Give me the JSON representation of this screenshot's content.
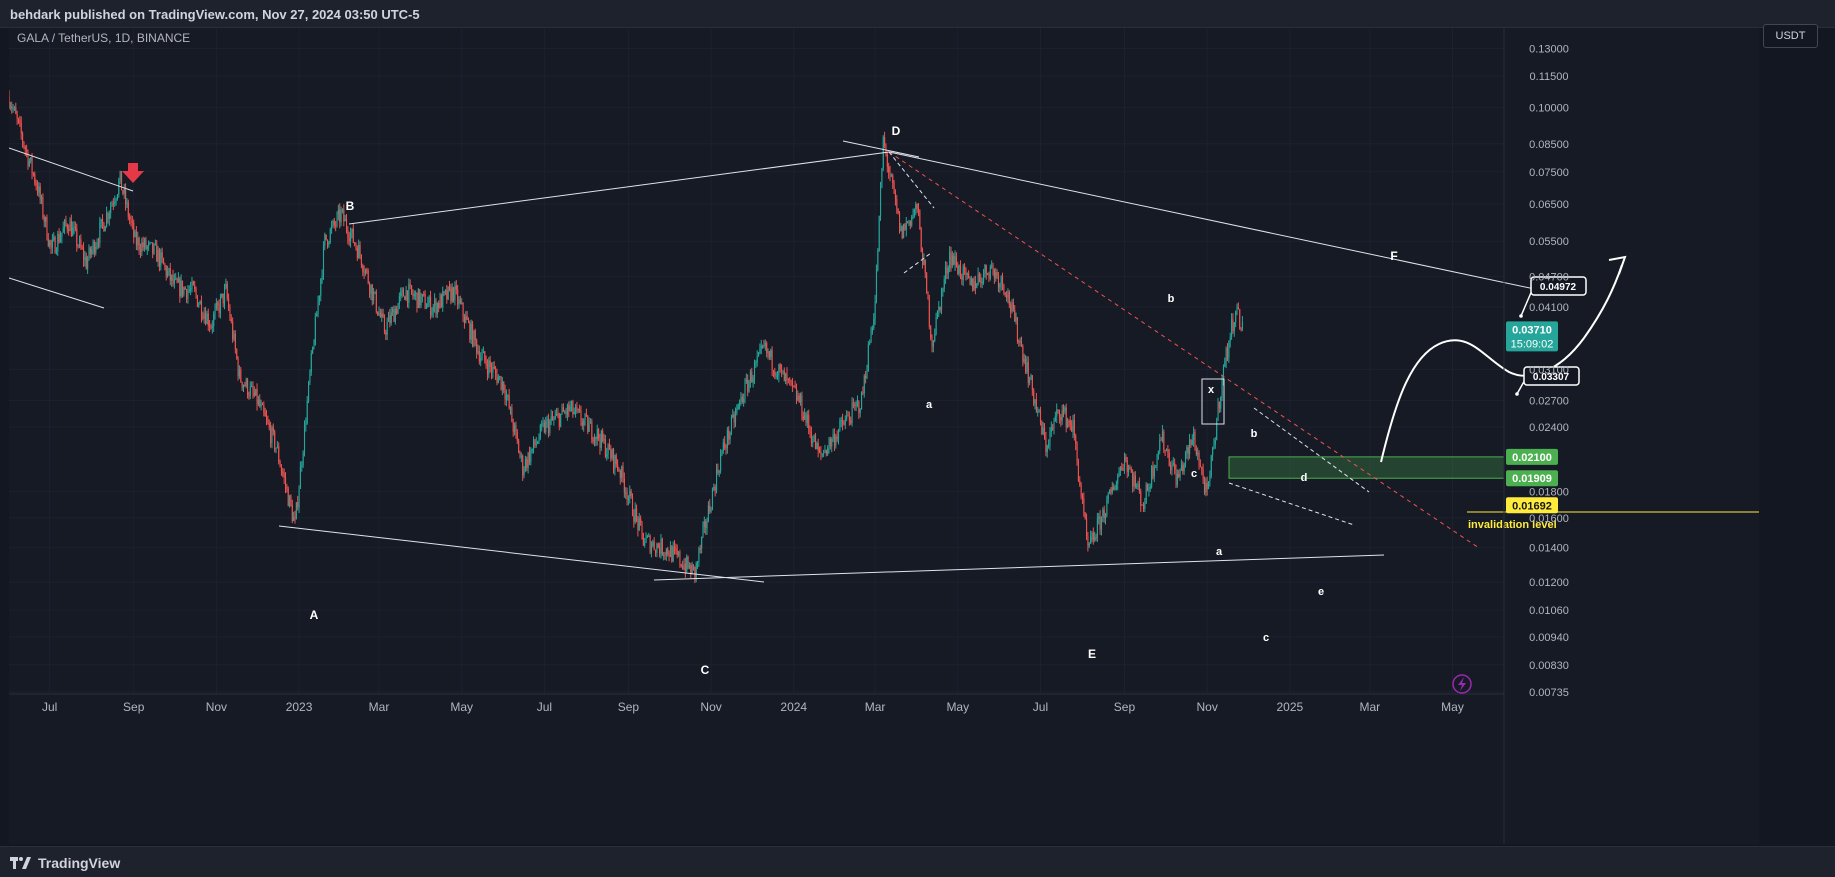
{
  "header": {
    "publisher": "behdark published on TradingView.com, Nov 27, 2024 03:50 UTC-5"
  },
  "footer": {
    "brand": "TradingView"
  },
  "symbol_label": "GALA / TetherUS, 1D, BINANCE",
  "currency_button": "USDT",
  "colors": {
    "background": "#161a25",
    "up": "#26a69a",
    "down": "#ef5350",
    "line": "#e0e3eb",
    "zone": "#4caf50",
    "invalidation": "#ffeb3b",
    "last_price_badge": "#26a69a",
    "arrow_marker": "#e53948"
  },
  "chart_data": {
    "type": "candlestick",
    "symbol": "GALA / TetherUS",
    "interval": "1D",
    "exchange": "BINANCE",
    "y_scale": "log",
    "ylim": [
      0.00735,
      0.14
    ],
    "y_ticks": [
      "0.13000",
      "0.11500",
      "0.10000",
      "0.08500",
      "0.07500",
      "0.06500",
      "0.05500",
      "0.04700",
      "0.04100",
      "0.03100",
      "0.02700",
      "0.02400",
      "0.01800",
      "0.01600",
      "0.01400",
      "0.01200",
      "0.01060",
      "0.00940",
      "0.00830",
      "0.00735"
    ],
    "x_ticks": [
      "Jul",
      "Sep",
      "Nov",
      "2023",
      "Mar",
      "May",
      "Jul",
      "Sep",
      "Nov",
      "2024",
      "Mar",
      "May",
      "Jul",
      "Sep",
      "Nov",
      "2025",
      "Mar",
      "May"
    ],
    "price_path": [
      [
        "2022-06-01",
        0.105
      ],
      [
        "2022-06-12",
        0.085
      ],
      [
        "2022-06-22",
        0.07
      ],
      [
        "2022-07-02",
        0.053
      ],
      [
        "2022-07-15",
        0.06
      ],
      [
        "2022-07-28",
        0.05
      ],
      [
        "2022-08-10",
        0.06
      ],
      [
        "2022-08-22",
        0.072
      ],
      [
        "2022-09-02",
        0.055
      ],
      [
        "2022-09-18",
        0.052
      ],
      [
        "2022-10-01",
        0.045
      ],
      [
        "2022-10-15",
        0.044
      ],
      [
        "2022-10-28",
        0.038
      ],
      [
        "2022-11-08",
        0.044
      ],
      [
        "2022-11-18",
        0.03
      ],
      [
        "2022-12-01",
        0.027
      ],
      [
        "2022-12-15",
        0.022
      ],
      [
        "2022-12-29",
        0.0155
      ],
      [
        "2023-01-10",
        0.032
      ],
      [
        "2023-01-20",
        0.055
      ],
      [
        "2023-02-01",
        0.062
      ],
      [
        "2023-02-15",
        0.052
      ],
      [
        "2023-03-05",
        0.037
      ],
      [
        "2023-03-20",
        0.044
      ],
      [
        "2023-04-10",
        0.041
      ],
      [
        "2023-04-25",
        0.044
      ],
      [
        "2023-05-15",
        0.033
      ],
      [
        "2023-06-01",
        0.029
      ],
      [
        "2023-06-15",
        0.02
      ],
      [
        "2023-07-01",
        0.024
      ],
      [
        "2023-07-20",
        0.026
      ],
      [
        "2023-08-10",
        0.023
      ],
      [
        "2023-08-25",
        0.02
      ],
      [
        "2023-09-12",
        0.0145
      ],
      [
        "2023-10-01",
        0.0138
      ],
      [
        "2023-10-20",
        0.0125
      ],
      [
        "2023-11-08",
        0.021
      ],
      [
        "2023-11-25",
        0.028
      ],
      [
        "2023-12-10",
        0.034
      ],
      [
        "2023-12-20",
        0.031
      ],
      [
        "2024-01-05",
        0.027
      ],
      [
        "2024-01-20",
        0.021
      ],
      [
        "2024-02-05",
        0.024
      ],
      [
        "2024-02-20",
        0.027
      ],
      [
        "2024-03-01",
        0.042
      ],
      [
        "2024-03-07",
        0.086
      ],
      [
        "2024-03-20",
        0.057
      ],
      [
        "2024-04-01",
        0.064
      ],
      [
        "2024-04-12",
        0.035
      ],
      [
        "2024-04-25",
        0.052
      ],
      [
        "2024-05-10",
        0.045
      ],
      [
        "2024-05-25",
        0.049
      ],
      [
        "2024-06-05",
        0.045
      ],
      [
        "2024-06-20",
        0.032
      ],
      [
        "2024-07-05",
        0.022
      ],
      [
        "2024-07-15",
        0.026
      ],
      [
        "2024-07-25",
        0.024
      ],
      [
        "2024-08-05",
        0.0138
      ],
      [
        "2024-08-20",
        0.0172
      ],
      [
        "2024-09-01",
        0.021
      ],
      [
        "2024-09-15",
        0.017
      ],
      [
        "2024-09-28",
        0.023
      ],
      [
        "2024-10-10",
        0.019
      ],
      [
        "2024-10-22",
        0.023
      ],
      [
        "2024-11-01",
        0.0175
      ],
      [
        "2024-11-12",
        0.03
      ],
      [
        "2024-11-22",
        0.041
      ],
      [
        "2024-11-27",
        0.0371
      ]
    ],
    "last_price": {
      "value": "0.03710",
      "countdown": "15:09:02"
    },
    "zone": {
      "top": "0.02100",
      "bottom": "0.01909"
    },
    "invalidation": {
      "value": "0.01692",
      "label": "invalidation level"
    },
    "targets": [
      "0.04972",
      "0.03307"
    ],
    "wave_labels_major": [
      "A",
      "B",
      "C",
      "D",
      "E",
      "F"
    ],
    "wave_labels_minor": [
      "a",
      "b",
      "x",
      "c",
      "b",
      "d",
      "a",
      "e",
      "c"
    ]
  }
}
